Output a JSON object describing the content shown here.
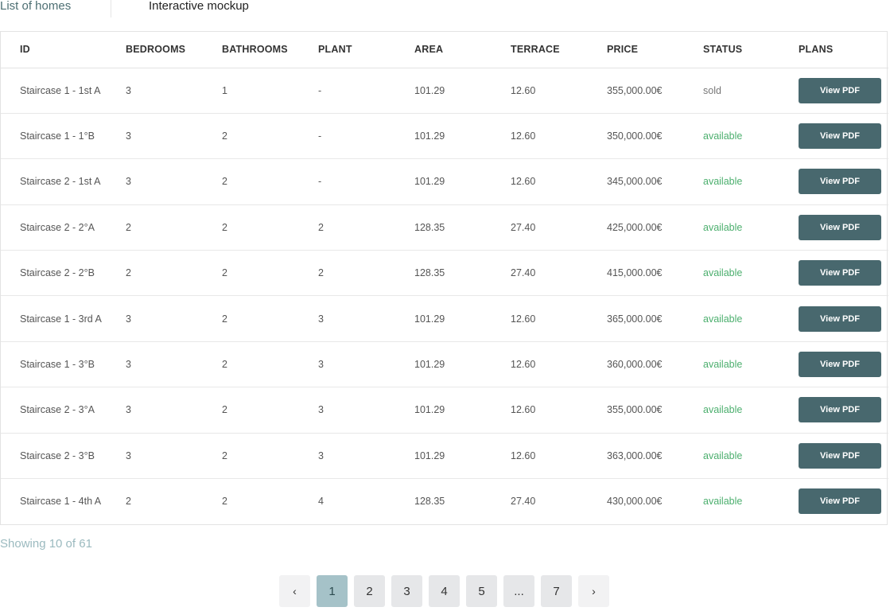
{
  "tabs": {
    "list_label": "List of homes",
    "mockup_label": "Interactive mockup"
  },
  "table": {
    "headers": [
      "ID",
      "BEDROOMS",
      "BATHROOMS",
      "PLANT",
      "AREA",
      "TERRACE",
      "PRICE",
      "STATUS",
      "PLANS"
    ],
    "button_label": "View PDF",
    "rows": [
      {
        "id": "Staircase 1 - 1st A",
        "bedrooms": "3",
        "bathrooms": "1",
        "plant": "-",
        "area": "101.29",
        "terrace": "12.60",
        "price": "355,000.00€",
        "status": "sold"
      },
      {
        "id": "Staircase 1 - 1°B",
        "bedrooms": "3",
        "bathrooms": "2",
        "plant": "-",
        "area": "101.29",
        "terrace": "12.60",
        "price": "350,000.00€",
        "status": "available"
      },
      {
        "id": "Staircase 2 - 1st A",
        "bedrooms": "3",
        "bathrooms": "2",
        "plant": "-",
        "area": "101.29",
        "terrace": "12.60",
        "price": "345,000.00€",
        "status": "available"
      },
      {
        "id": "Staircase 2 - 2°A",
        "bedrooms": "2",
        "bathrooms": "2",
        "plant": "2",
        "area": "128.35",
        "terrace": "27.40",
        "price": "425,000.00€",
        "status": "available"
      },
      {
        "id": "Staircase 2 - 2°B",
        "bedrooms": "2",
        "bathrooms": "2",
        "plant": "2",
        "area": "128.35",
        "terrace": "27.40",
        "price": "415,000.00€",
        "status": "available"
      },
      {
        "id": "Staircase 1 - 3rd A",
        "bedrooms": "3",
        "bathrooms": "2",
        "plant": "3",
        "area": "101.29",
        "terrace": "12.60",
        "price": "365,000.00€",
        "status": "available"
      },
      {
        "id": "Staircase 1 - 3°B",
        "bedrooms": "3",
        "bathrooms": "2",
        "plant": "3",
        "area": "101.29",
        "terrace": "12.60",
        "price": "360,000.00€",
        "status": "available"
      },
      {
        "id": "Staircase 2 - 3°A",
        "bedrooms": "3",
        "bathrooms": "2",
        "plant": "3",
        "area": "101.29",
        "terrace": "12.60",
        "price": "355,000.00€",
        "status": "available"
      },
      {
        "id": "Staircase 2 - 3°B",
        "bedrooms": "3",
        "bathrooms": "2",
        "plant": "3",
        "area": "101.29",
        "terrace": "12.60",
        "price": "363,000.00€",
        "status": "available"
      },
      {
        "id": "Staircase 1 - 4th A",
        "bedrooms": "2",
        "bathrooms": "2",
        "plant": "4",
        "area": "128.35",
        "terrace": "27.40",
        "price": "430,000.00€",
        "status": "available"
      }
    ]
  },
  "footer": {
    "showing": "Showing 10 of 61"
  },
  "pagination": {
    "prev": "‹",
    "next": "›",
    "pages": [
      "1",
      "2",
      "3",
      "4",
      "5",
      "...",
      "7"
    ],
    "active": "1"
  },
  "colors": {
    "accent": "#48686e",
    "available": "#4caf6e",
    "active_page": "#a5c2c8"
  }
}
